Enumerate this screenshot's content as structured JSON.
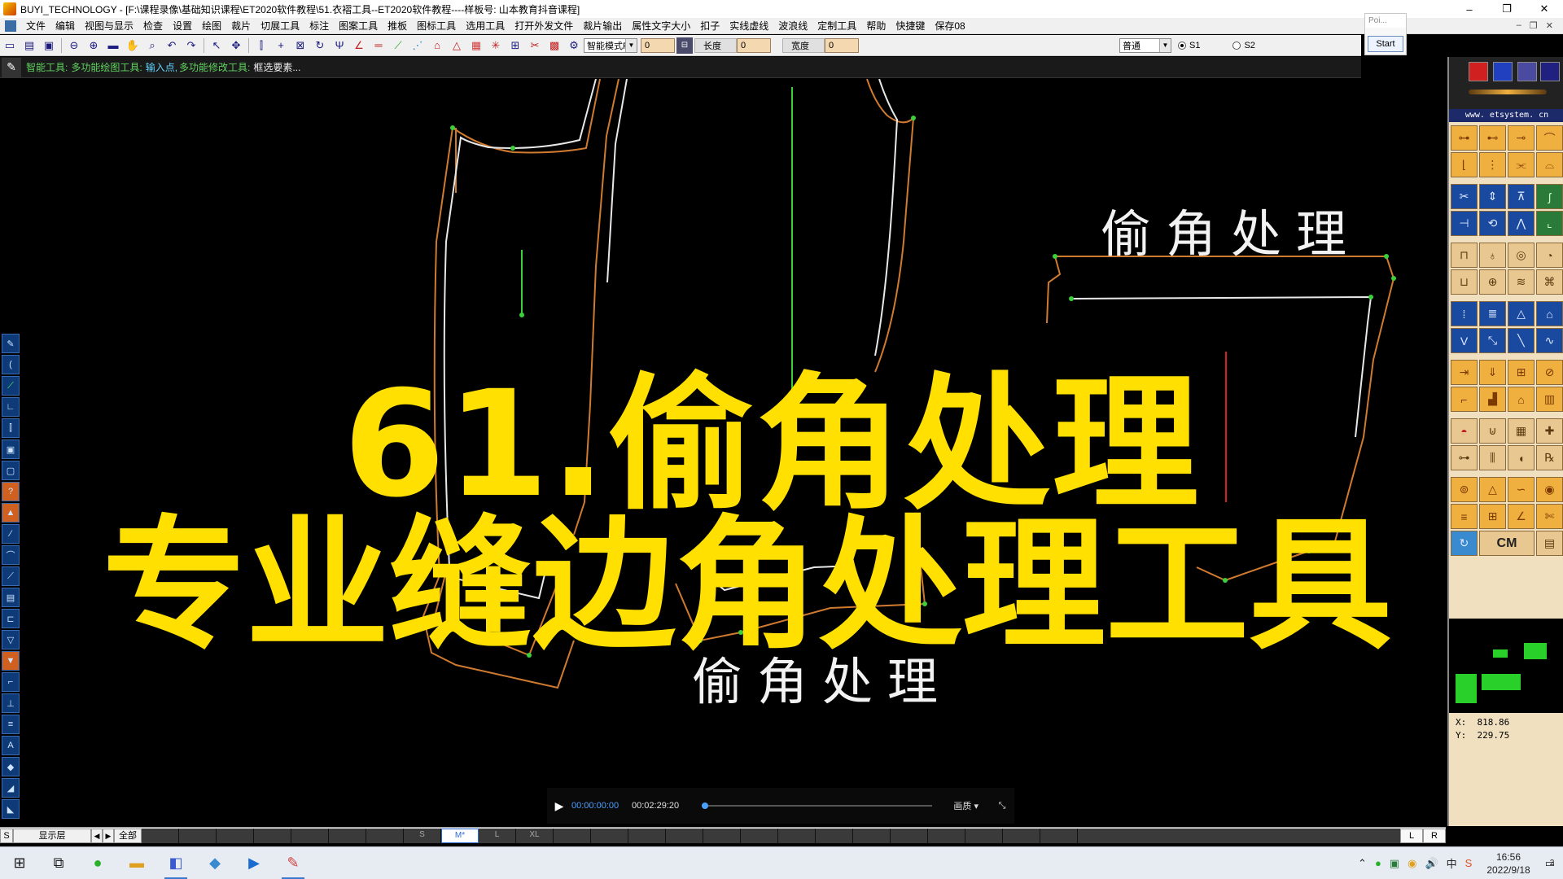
{
  "window": {
    "title": "BUYI_TECHNOLOGY - [F:\\课程录像\\基础知识课程\\ET2020软件教程\\51.衣褶工具--ET2020软件教程----样板号: 山本教育抖音课程]",
    "minimize": "–",
    "maximize": "❐",
    "close": "✕"
  },
  "menu": {
    "items": [
      "文件",
      "编辑",
      "视图与显示",
      "检查",
      "设置",
      "绘图",
      "裁片",
      "切展工具",
      "标注",
      "图案工具",
      "推板",
      "图标工具",
      "选用工具",
      "打开外发文件",
      "裁片输出",
      "属性文字大小",
      "扣子",
      "实线虚线",
      "波浪线",
      "定制工具",
      "帮助",
      "快捷键",
      "保存08"
    ],
    "mdi_min": "–",
    "mdi_restore": "❐",
    "mdi_close": "✕"
  },
  "toolbar": {
    "mode_select": "智能模式F5",
    "value_field": "0",
    "length_label": "长度",
    "length_value": "0",
    "width_label": "宽度",
    "width_value": "0",
    "line_style": "普通",
    "radio_s1": "S1",
    "radio_s2": "S2"
  },
  "start_popup": {
    "title": "Poi...",
    "button": "Start"
  },
  "prompt": {
    "tool": "智能工具:",
    "draw_tool": "多功能绘图工具:",
    "draw_hint": "输入点,",
    "modify_tool": "多功能修改工具:",
    "modify_hint": "框选要素..."
  },
  "overlay": {
    "line1": "61.偷角处理",
    "line2": "专业缝边角处理工具",
    "label_top": "偷角处理",
    "label_bottom": "偷角处理"
  },
  "video": {
    "current": "00:00:00:00",
    "total": "00:02:29:20",
    "progress": 0,
    "quality": "画质 ▾"
  },
  "right_panel": {
    "url": "www. etsystem. cn",
    "cm_label": "CM",
    "x_label": "X:",
    "x_value": "818.86",
    "y_label": "Y:",
    "y_value": "229.75"
  },
  "sizebar": {
    "s": "S",
    "layer": "显示层",
    "all": "全部",
    "sizes": [
      "",
      "",
      "",
      "",
      "",
      "",
      "",
      "S",
      "M*",
      "L",
      "XL",
      "",
      "",
      "",
      "",
      "",
      "",
      "",
      "",
      "",
      "",
      "",
      "",
      "",
      ""
    ],
    "active_size": "M*",
    "l": "L",
    "r": "R"
  },
  "taskbar": {
    "time": "16:56",
    "date": "2022/9/18",
    "notif_count": "2"
  },
  "colors": {
    "title_yellow": "#ffe000",
    "pattern_orange": "#d07a30",
    "pattern_white": "#e8e8e8",
    "point_green": "#3ad03a",
    "line_red": "#d02020"
  }
}
